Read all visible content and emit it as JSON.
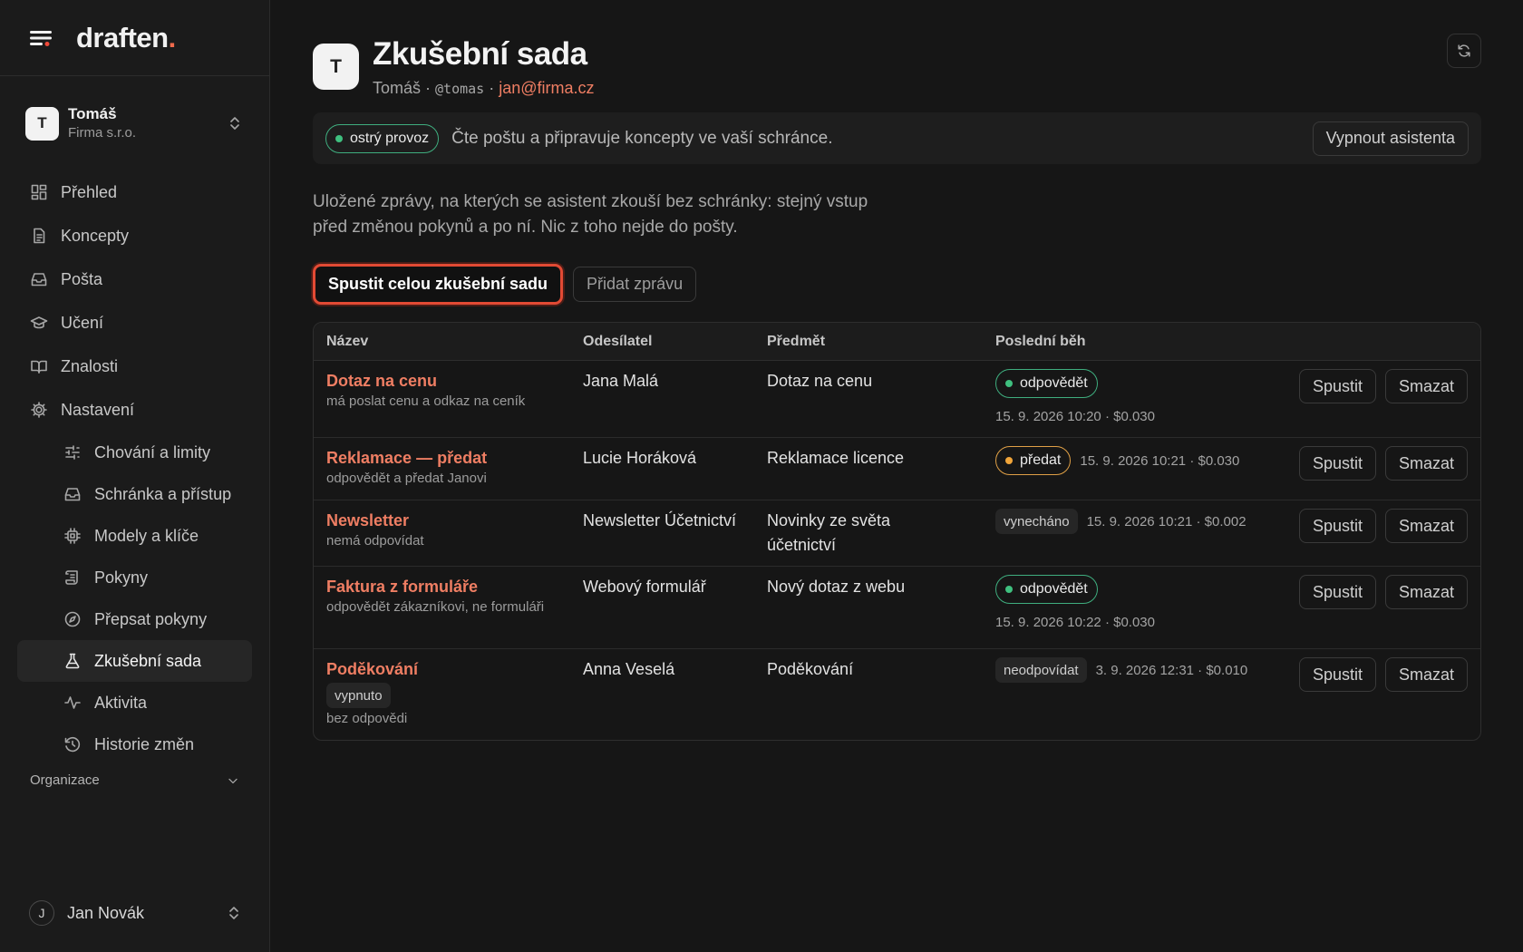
{
  "brand": {
    "name": "draften",
    "dot": "."
  },
  "account": {
    "initial": "T",
    "name": "Tomáš",
    "org": "Firma s.r.o."
  },
  "nav": [
    {
      "label": "Přehled"
    },
    {
      "label": "Koncepty"
    },
    {
      "label": "Pošta"
    },
    {
      "label": "Učení"
    },
    {
      "label": "Znalosti"
    },
    {
      "label": "Nastavení"
    }
  ],
  "subnav": [
    {
      "label": "Chování a limity"
    },
    {
      "label": "Schránka a přístup"
    },
    {
      "label": "Modely a klíče"
    },
    {
      "label": "Pokyny"
    },
    {
      "label": "Přepsat pokyny"
    },
    {
      "label": "Zkušební sada"
    },
    {
      "label": "Aktivita"
    },
    {
      "label": "Historie změn"
    }
  ],
  "org_section": "Organizace",
  "user": {
    "initial": "J",
    "name": "Jan Novák"
  },
  "header": {
    "initial": "T",
    "title": "Zkušební sada",
    "owner": "Tomáš",
    "sep1": " · ",
    "handle": "@tomas",
    "sep2": " · ",
    "email": "jan@firma.cz"
  },
  "status": {
    "mode": "ostrý provoz",
    "text": "Čte poštu a připravuje koncepty ve vaší schránce.",
    "disable_label": "Vypnout asistenta"
  },
  "description": "Uložené zprávy, na kterých se asistent zkouší bez schránky: stejný vstup před změnou pokynů a po ní. Nic z toho nejde do pošty.",
  "actions": {
    "run_all": "Spustit celou zkušební sadu",
    "add": "Přidat zprávu"
  },
  "table": {
    "headers": [
      "Název",
      "Odesílatel",
      "Předmět",
      "Poslední běh"
    ],
    "run_label": "Spustit",
    "delete_label": "Smazat",
    "rows": [
      {
        "name": "Dotaz na cenu",
        "tag": "",
        "note": "má poslat cenu a odkaz na ceník",
        "sender": "Jana Malá",
        "subject": "Dotaz na cenu",
        "result": "odpovědět",
        "result_style": "green",
        "meta": "15. 9. 2026 10:20 · $0.030"
      },
      {
        "name": "Reklamace — předat",
        "tag": "",
        "note": "odpovědět a předat Janovi",
        "sender": "Lucie Horáková",
        "subject": "Reklamace licence",
        "result": "předat",
        "result_style": "orange",
        "meta": "15. 9. 2026 10:21 · $0.030"
      },
      {
        "name": "Newsletter",
        "tag": "",
        "note": "nemá odpovídat",
        "sender": "Newsletter Účetnictví",
        "subject": "Novinky ze světa účetnictví",
        "result": "vynecháno",
        "result_style": "gray",
        "meta": "15. 9. 2026 10:21 · $0.002"
      },
      {
        "name": "Faktura z formuláře",
        "tag": "",
        "note": "odpovědět zákazníkovi, ne formuláři",
        "sender": "Webový formulář",
        "subject": "Nový dotaz z webu",
        "result": "odpovědět",
        "result_style": "green",
        "meta": "15. 9. 2026 10:22 · $0.030"
      },
      {
        "name": "Poděkování",
        "tag": "vypnuto",
        "note": "bez odpovědi",
        "sender": "Anna Veselá",
        "subject": "Poděkování",
        "result": "neodpovídat",
        "result_style": "gray",
        "meta": "3. 9. 2026 12:31 · $0.010"
      }
    ]
  }
}
